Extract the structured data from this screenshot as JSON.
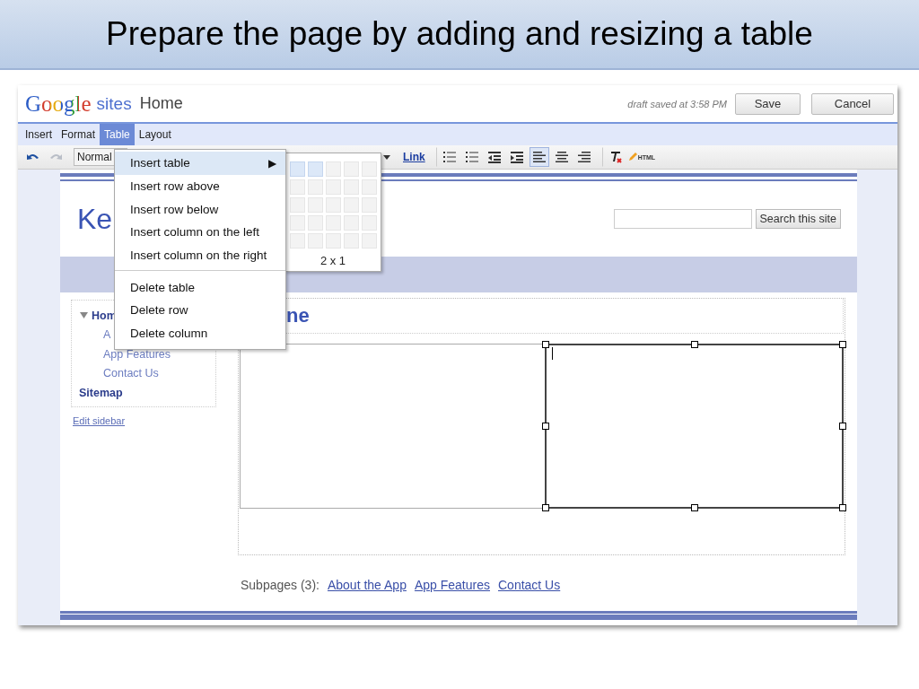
{
  "slide_title": "Prepare the page by adding and resizing a table",
  "header": {
    "logo": "Google",
    "product": "sites",
    "page": "Home",
    "draft_status": "draft saved at 3:58 PM",
    "buttons": [
      "Save",
      "Cancel"
    ]
  },
  "menubar": [
    {
      "label": "Insert",
      "selected": false
    },
    {
      "label": "Format",
      "selected": false
    },
    {
      "label": "Table",
      "selected": true
    },
    {
      "label": "Layout",
      "selected": false
    }
  ],
  "toolbar": [
    {
      "kind": "undo",
      "selected": false
    },
    {
      "kind": "redo",
      "selected": false
    },
    {
      "kind": "style",
      "label": "Normal",
      "selected": false
    },
    {
      "kind": "caret",
      "selected": false
    },
    {
      "kind": "link",
      "label": "Link",
      "selected": false
    },
    {
      "kind": "numbered-list",
      "selected": false
    },
    {
      "kind": "bulleted-list",
      "selected": false
    },
    {
      "kind": "outdent",
      "selected": false
    },
    {
      "kind": "indent",
      "selected": false
    },
    {
      "kind": "align-left",
      "selected": true
    },
    {
      "kind": "align-center",
      "selected": false
    },
    {
      "kind": "align-right",
      "selected": false
    },
    {
      "kind": "clear-format",
      "selected": false
    },
    {
      "kind": "html",
      "label": "HTML",
      "selected": false
    }
  ],
  "menu": {
    "items": [
      {
        "kind": "submenu",
        "label": "Insert table",
        "arrow": "▶",
        "selected": true
      },
      {
        "kind": "item",
        "label": "Insert row above",
        "selected": false
      },
      {
        "kind": "item",
        "label": "Insert row below",
        "selected": false
      },
      {
        "kind": "item",
        "label": "Insert column on the left",
        "selected": false
      },
      {
        "kind": "item",
        "label": "Insert column on the right",
        "selected": false
      },
      {
        "kind": "separator"
      },
      {
        "kind": "item",
        "label": "Delete table",
        "selected": false
      },
      {
        "kind": "item",
        "label": "Delete row",
        "selected": false
      },
      {
        "kind": "item",
        "label": "Delete column",
        "selected": false
      }
    ],
    "table_picker": {
      "grid": [
        [
          {
            "selected": true
          },
          {
            "selected": true
          },
          {
            "selected": false
          },
          {
            "selected": false
          },
          {
            "selected": false
          }
        ],
        [
          {
            "selected": false
          },
          {
            "selected": false
          },
          {
            "selected": false
          },
          {
            "selected": false
          },
          {
            "selected": false
          }
        ],
        [
          {
            "selected": false
          },
          {
            "selected": false
          },
          {
            "selected": false
          },
          {
            "selected": false
          },
          {
            "selected": false
          }
        ],
        [
          {
            "selected": false
          },
          {
            "selected": false
          },
          {
            "selected": false
          },
          {
            "selected": false
          },
          {
            "selected": false
          }
        ],
        [
          {
            "selected": false
          },
          {
            "selected": false
          },
          {
            "selected": false
          },
          {
            "selected": false
          },
          {
            "selected": false
          }
        ]
      ],
      "size_label": "2 x 1"
    }
  },
  "site": {
    "title": "Ke",
    "search_button": "Search this site"
  },
  "sidebar": {
    "items": [
      {
        "label": "Hom",
        "expanded": true,
        "children": [
          {
            "label": "A"
          },
          {
            "label": "App Features"
          },
          {
            "label": "Contact Us"
          }
        ]
      },
      {
        "label": "Sitemap"
      }
    ],
    "edit_link": "Edit sidebar"
  },
  "page_title": "ne",
  "table": {
    "cells": [
      {
        "selected": false
      },
      {
        "selected": true
      }
    ]
  },
  "subpages": {
    "label": "Subpages (3):",
    "links": [
      "About the App",
      "App Features",
      "Contact Us"
    ]
  }
}
